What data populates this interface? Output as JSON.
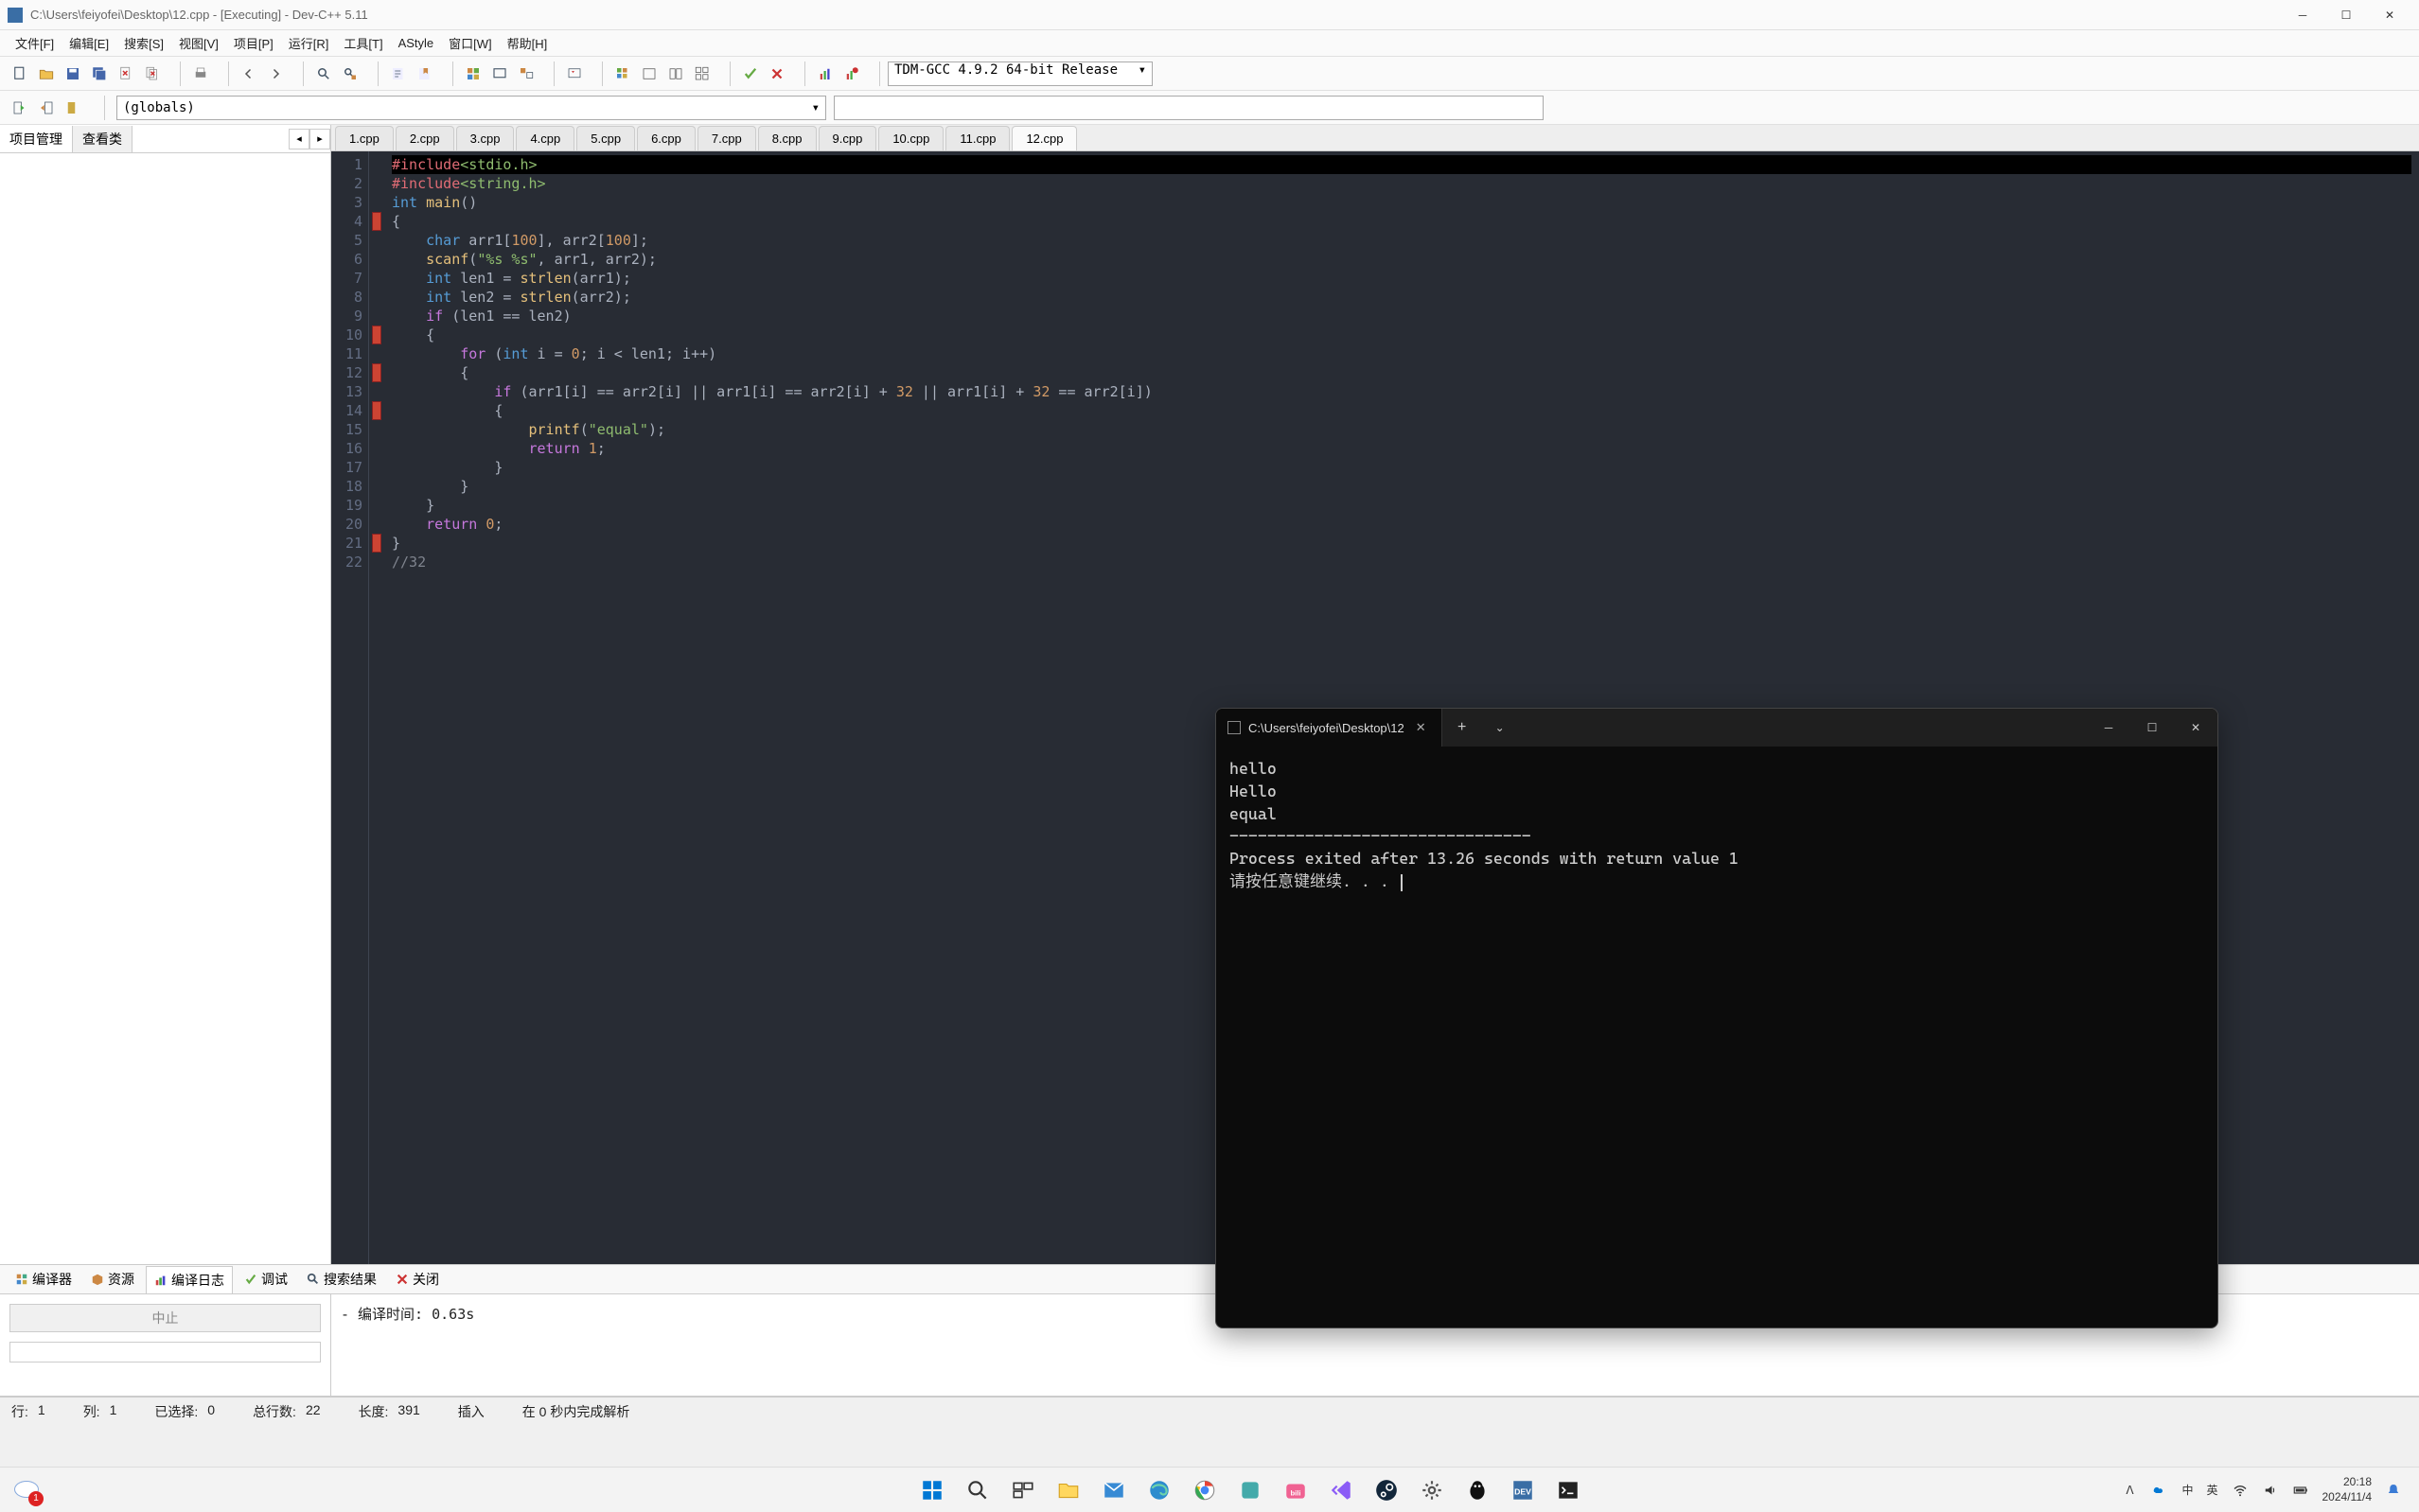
{
  "window": {
    "title": "C:\\Users\\feiyofei\\Desktop\\12.cpp - [Executing] - Dev-C++ 5.11"
  },
  "menus": [
    "文件[F]",
    "编辑[E]",
    "搜索[S]",
    "视图[V]",
    "项目[P]",
    "运行[R]",
    "工具[T]",
    "AStyle",
    "窗口[W]",
    "帮助[H]"
  ],
  "compiler_select": "TDM-GCC 4.9.2 64-bit Release",
  "globals_select": "(globals)",
  "left_tabs": [
    "项目管理",
    "查看类"
  ],
  "file_tabs": [
    "1.cpp",
    "2.cpp",
    "3.cpp",
    "4.cpp",
    "5.cpp",
    "6.cpp",
    "7.cpp",
    "8.cpp",
    "9.cpp",
    "10.cpp",
    "11.cpp",
    "12.cpp"
  ],
  "active_file_tab": "12.cpp",
  "code_lines": [
    {
      "n": 1,
      "hl": true,
      "html": "<span class='pp'>#include</span><span class='str'>&lt;stdio.h&gt;</span>"
    },
    {
      "n": 2,
      "html": "<span class='pp'>#include</span><span class='str'>&lt;string.h&gt;</span>"
    },
    {
      "n": 3,
      "html": "<span class='type'>int</span> <span class='fn'>main</span>()"
    },
    {
      "n": 4,
      "fold": true,
      "html": "{"
    },
    {
      "n": 5,
      "html": "    <span class='type'>char</span> arr1[<span class='num'>100</span>], arr2[<span class='num'>100</span>];"
    },
    {
      "n": 6,
      "html": "    <span class='fn'>scanf</span>(<span class='str'>\"%s %s\"</span>, arr1, arr2);"
    },
    {
      "n": 7,
      "html": "    <span class='type'>int</span> len1 = <span class='fn'>strlen</span>(arr1);"
    },
    {
      "n": 8,
      "html": "    <span class='type'>int</span> len2 = <span class='fn'>strlen</span>(arr2);"
    },
    {
      "n": 9,
      "html": "    <span class='kw'>if</span> (len1 == len2)"
    },
    {
      "n": 10,
      "fold": true,
      "html": "    {"
    },
    {
      "n": 11,
      "html": "        <span class='kw'>for</span> (<span class='type'>int</span> i = <span class='num'>0</span>; i &lt; len1; i++)"
    },
    {
      "n": 12,
      "fold": true,
      "html": "        {"
    },
    {
      "n": 13,
      "html": "            <span class='kw'>if</span> (arr1[i] == arr2[i] || arr1[i] == arr2[i] + <span class='num'>32</span> || arr1[i] + <span class='num'>32</span> == arr2[i])"
    },
    {
      "n": 14,
      "fold": true,
      "html": "            {"
    },
    {
      "n": 15,
      "html": "                <span class='fn'>printf</span>(<span class='str'>\"equal\"</span>);"
    },
    {
      "n": 16,
      "html": "                <span class='kw'>return</span> <span class='num'>1</span>;"
    },
    {
      "n": 17,
      "html": "            }"
    },
    {
      "n": 18,
      "html": "        }"
    },
    {
      "n": 19,
      "html": "    }"
    },
    {
      "n": 20,
      "html": "    <span class='kw'>return</span> <span class='num'>0</span>;"
    },
    {
      "n": 21,
      "fold": true,
      "html": "}"
    },
    {
      "n": 22,
      "html": "<span class='cmt'>//32</span>"
    }
  ],
  "bottom_tabs": [
    {
      "icon": "grid",
      "label": "编译器"
    },
    {
      "icon": "cube",
      "label": "资源"
    },
    {
      "icon": "chart",
      "label": "编译日志",
      "active": true
    },
    {
      "icon": "check",
      "label": "调试"
    },
    {
      "icon": "search",
      "label": "搜索结果"
    },
    {
      "icon": "x",
      "label": "关闭"
    }
  ],
  "abort_label": "中止",
  "compile_log": "- 编译时间: 0.63s",
  "statusbar": {
    "line": "行:",
    "line_val": "1",
    "col": "列:",
    "col_val": "1",
    "sel": "已选择:",
    "sel_val": "0",
    "total": "总行数:",
    "total_val": "22",
    "length": "长度:",
    "length_val": "391",
    "mode": "插入",
    "parse": "在 0 秒内完成解析"
  },
  "terminal": {
    "tab_title": "C:\\Users\\feiyofei\\Desktop\\12",
    "output": "hello\nHello\nequal\n--------------------------------\nProcess exited after 13.26 seconds with return value 1\n请按任意键继续. . . "
  },
  "taskbar": {
    "weather_badge": "1",
    "clock_time": "20:18",
    "clock_date": "2024/11/4",
    "ime1": "中",
    "ime2": "英"
  }
}
